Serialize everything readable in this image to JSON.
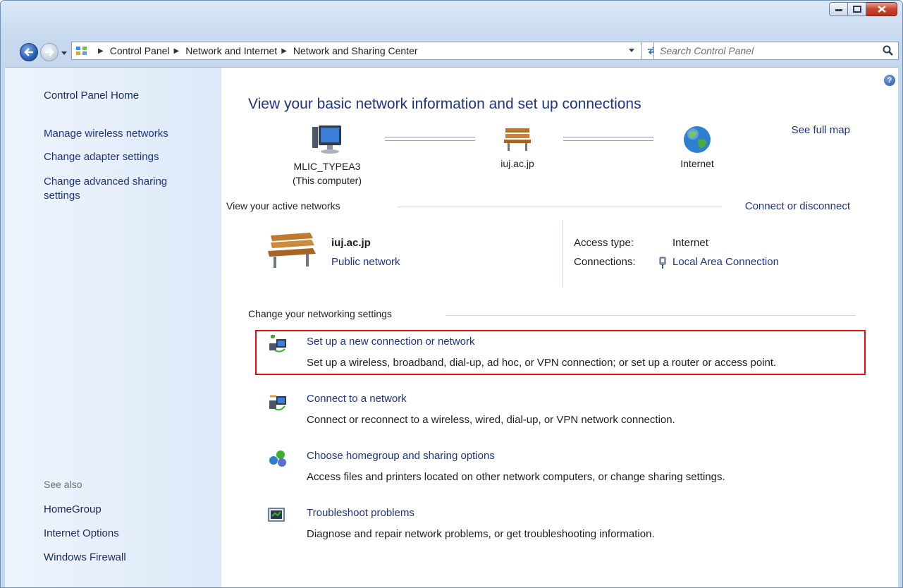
{
  "window": {
    "caption_buttons": {
      "minimize": "minimize-icon",
      "maximize": "maximize-icon",
      "close": "close-icon"
    }
  },
  "address_bar": {
    "breadcrumbs": [
      "Control Panel",
      "Network and Internet",
      "Network and Sharing Center"
    ],
    "search_placeholder": "Search Control Panel"
  },
  "sidebar": {
    "home": "Control Panel Home",
    "tasks": [
      "Manage wireless networks",
      "Change adapter settings",
      "Change advanced sharing settings"
    ],
    "see_also_label": "See also",
    "see_also": [
      "HomeGroup",
      "Internet Options",
      "Windows Firewall"
    ]
  },
  "main": {
    "title": "View your basic network information and set up connections",
    "see_full_map": "See full map",
    "map": {
      "computer_name": "MLIC_TYPEA3",
      "computer_note": "(This computer)",
      "network_name": "iuj.ac.jp",
      "internet": "Internet"
    },
    "active_networks": {
      "header": "View your active networks",
      "connect_or_disconnect": "Connect or disconnect",
      "network_name": "iuj.ac.jp",
      "network_type": "Public network",
      "access_type_label": "Access type:",
      "access_type_value": "Internet",
      "connections_label": "Connections:",
      "connections_value": "Local Area Connection"
    },
    "change_settings": {
      "header": "Change your networking settings",
      "items": [
        {
          "title": "Set up a new connection or network",
          "desc": "Set up a wireless, broadband, dial-up, ad hoc, or VPN connection; or set up a router or access point."
        },
        {
          "title": "Connect to a network",
          "desc": "Connect or reconnect to a wireless, wired, dial-up, or VPN network connection."
        },
        {
          "title": "Choose homegroup and sharing options",
          "desc": "Access files and printers located on other network computers, or change sharing settings."
        },
        {
          "title": "Troubleshoot problems",
          "desc": "Diagnose and repair network problems, or get troubleshooting information."
        }
      ]
    }
  },
  "colors": {
    "link": "#1e3287",
    "highlight": "#e01010",
    "sidebar": "#dde9f8"
  }
}
